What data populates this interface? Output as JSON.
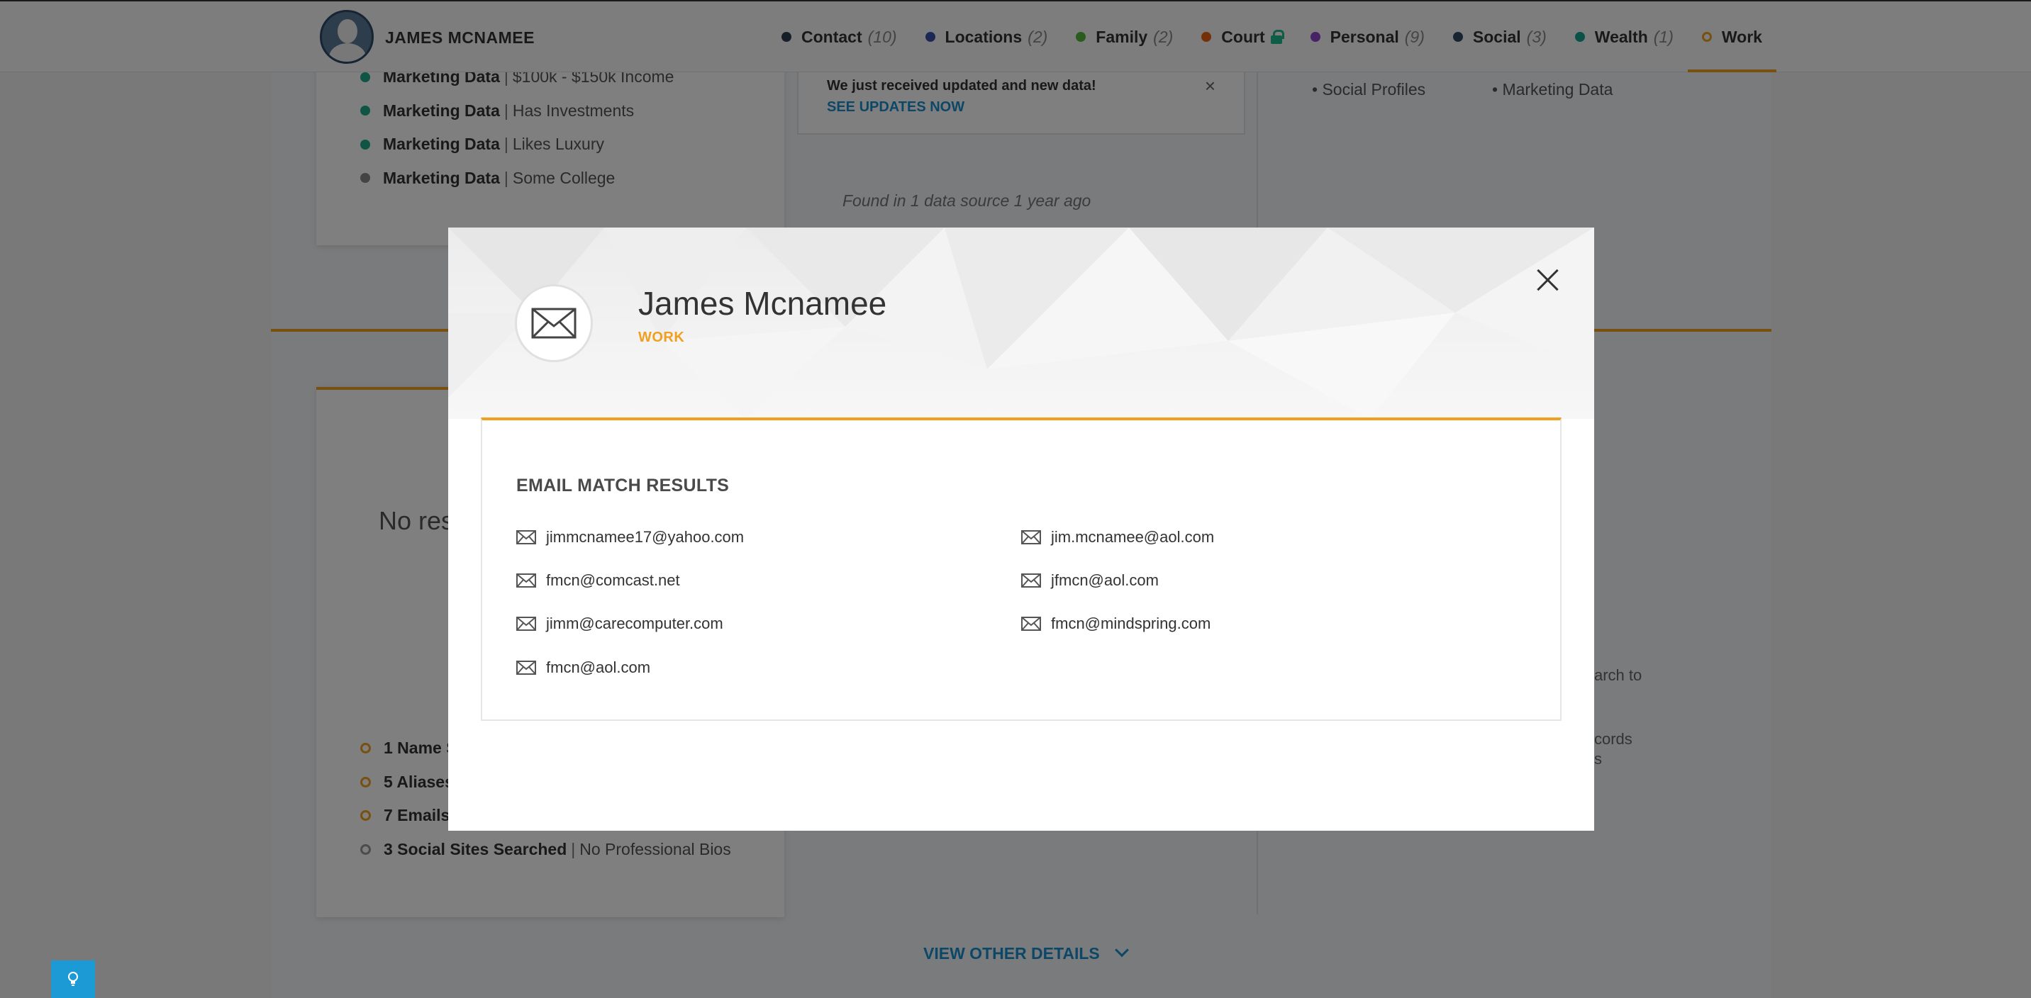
{
  "nav": {
    "name": "JAMES MCNAMEE",
    "tabs": [
      {
        "label": "Contact",
        "count": "(10)",
        "color": "#2c3e50"
      },
      {
        "label": "Locations",
        "count": "(2)",
        "color": "#3b4fa8"
      },
      {
        "label": "Family",
        "count": "(2)",
        "color": "#56b83a"
      },
      {
        "label": "Court",
        "count": "",
        "color": "#e8620f"
      },
      {
        "label": "Personal",
        "count": "(9)",
        "color": "#8f45c9"
      },
      {
        "label": "Social",
        "count": "(3)",
        "color": "#2e4a66"
      },
      {
        "label": "Wealth",
        "count": "(1)",
        "color": "#12a58e"
      },
      {
        "label": "Work",
        "count": "",
        "color": "#f0a020"
      }
    ]
  },
  "background": {
    "marketing": [
      {
        "bold": "Marketing Data",
        "text": "$100k - $150k Income",
        "color": "#1fa88a"
      },
      {
        "bold": "Marketing Data",
        "text": "Has Investments",
        "color": "#1fa88a"
      },
      {
        "bold": "Marketing Data",
        "text": "Likes Luxury",
        "color": "#1fa88a"
      },
      {
        "bold": "Marketing Data",
        "text": "Some College",
        "color": "#888888"
      }
    ],
    "notice_msg": "We just received updated and new data!",
    "notice_link": "SEE UPDATES NOW",
    "notice_close": "×",
    "found": "Found in 1 data source 1 year ago",
    "bullets_left": "• Social Profiles",
    "bullets_right": "• Marketing Data",
    "no_results": "No res",
    "summary": [
      {
        "bold": "1 Name S",
        "text": ""
      },
      {
        "bold": "5 Aliases",
        "text": ""
      },
      {
        "bold": "7 Emails",
        "text": ""
      },
      {
        "bold": "3 Social Sites Searched",
        "text": "No Professional Bios"
      }
    ],
    "side1": "arch to",
    "side2": "cords",
    "side3": "s",
    "view_other": "VIEW OTHER DETAILS"
  },
  "modal": {
    "name": "James Mcnamee",
    "tag": "WORK",
    "section_title": "EMAIL MATCH RESULTS",
    "emails_left": [
      "jimmcnamee17@yahoo.com",
      "fmcn@comcast.net",
      "jimm@carecomputer.com",
      "fmcn@aol.com"
    ],
    "emails_right": [
      "jim.mcnamee@aol.com",
      "jfmcn@aol.com",
      "fmcn@mindspring.com"
    ]
  },
  "colors": {
    "accent": "#f0a020",
    "link": "#1b8fcf"
  }
}
